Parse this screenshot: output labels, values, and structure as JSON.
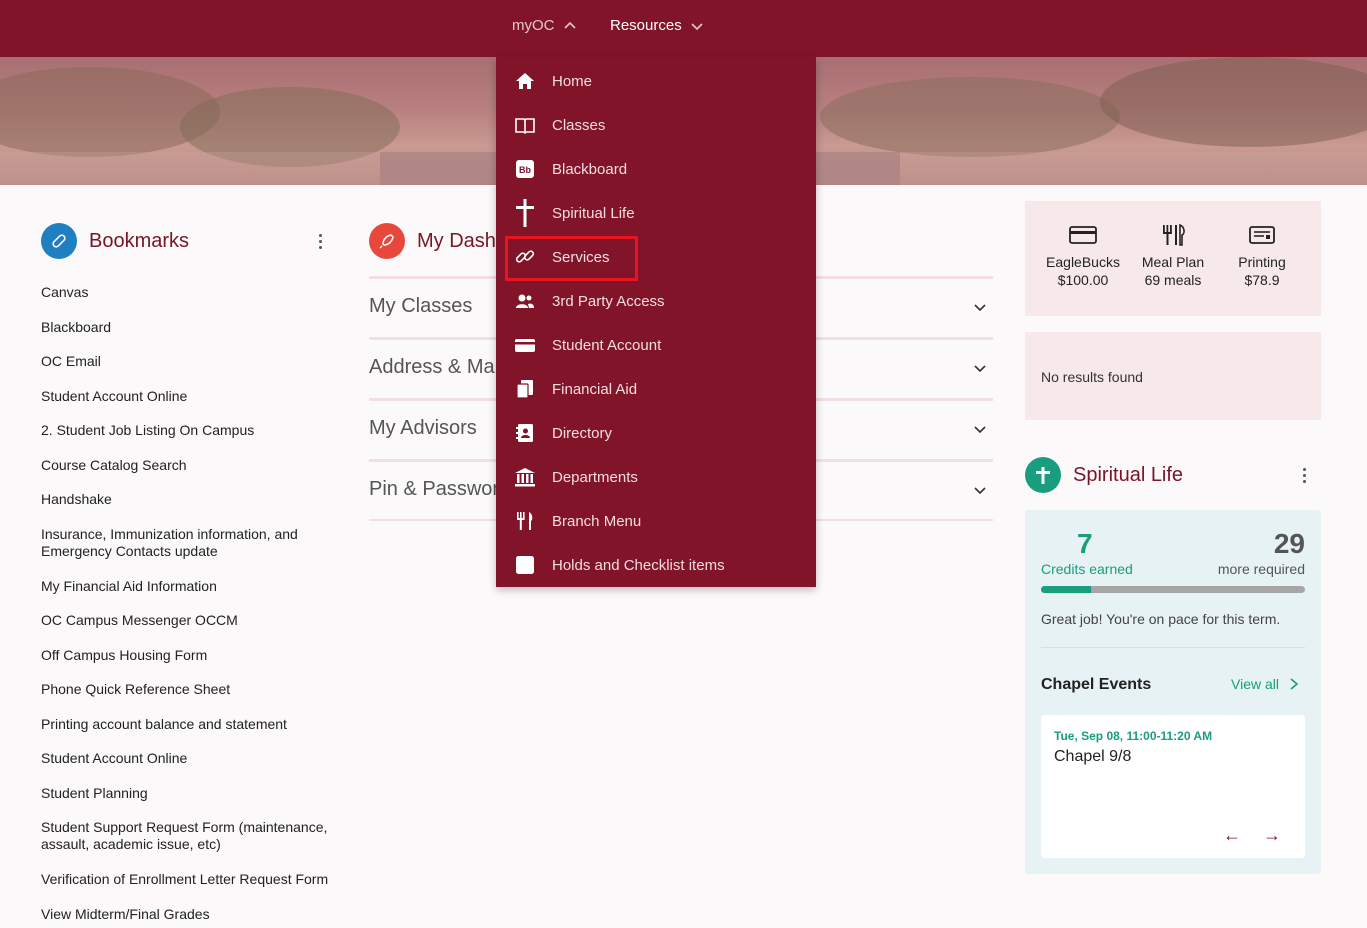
{
  "nav": {
    "myoc_label": "myOC",
    "resources_label": "Resources"
  },
  "bookmarks": {
    "title": "Bookmarks",
    "items": [
      "Canvas",
      "Blackboard",
      "OC Email",
      "Student Account Online",
      "2. Student Job Listing On Campus",
      "Course Catalog Search",
      "Handshake",
      "Insurance, Immunization information, and Emergency Contacts update",
      "My Financial Aid Information",
      "OC Campus Messenger OCCM",
      "Off Campus Housing Form",
      "Phone Quick Reference Sheet",
      "Printing account balance and statement",
      "Student Account Online",
      "Student Planning",
      "Student Support Request Form (maintenance, assault, academic issue, etc)",
      "Verification of Enrollment Letter Request Form",
      "View Midterm/Final Grades"
    ]
  },
  "dashboard": {
    "title": "My Dash",
    "sections": [
      "My Classes",
      "Address & Mai",
      "My Advisors",
      "Pin & Passwor"
    ]
  },
  "menu": {
    "items": [
      {
        "label": "Home",
        "icon": "home-icon"
      },
      {
        "label": "Classes",
        "icon": "book-icon"
      },
      {
        "label": "Blackboard",
        "icon": "blackboard-icon"
      },
      {
        "label": "Spiritual Life",
        "icon": "cross-icon"
      },
      {
        "label": "Services",
        "icon": "link-icon"
      },
      {
        "label": "3rd Party Access",
        "icon": "users-icon"
      },
      {
        "label": "Student Account",
        "icon": "credit-card-icon"
      },
      {
        "label": "Financial Aid",
        "icon": "financial-aid-icon"
      },
      {
        "label": "Directory",
        "icon": "address-book-icon"
      },
      {
        "label": "Departments",
        "icon": "building-icon"
      },
      {
        "label": "Branch Menu",
        "icon": "utensils-icon"
      },
      {
        "label": "Holds and Checklist items",
        "icon": "checkbox-icon"
      }
    ],
    "highlighted": "Services"
  },
  "wallet": {
    "items": [
      {
        "name": "EagleBucks",
        "value": "$100.00",
        "icon": "card-icon"
      },
      {
        "name": "Meal Plan",
        "value": "69 meals",
        "icon": "utensils-icon"
      },
      {
        "name": "Printing",
        "value": "$78.9",
        "icon": "printer-icon"
      }
    ]
  },
  "notice": {
    "text": "No results found"
  },
  "spiritual": {
    "title": "Spiritual Life",
    "credits_earned": "7",
    "credits_earned_label": "Credits earned",
    "more_required": "29",
    "more_required_label": "more required",
    "progress_fraction": 0.19,
    "message": "Great job! You're on pace for this term.",
    "events_title": "Chapel Events",
    "view_all": "View all",
    "event": {
      "date": "Tue, Sep 08, 11:00-11:20 AM",
      "name": "Chapel 9/8"
    },
    "prev_arrow": "←",
    "next_arrow": "→"
  },
  "colors": {
    "brand": "#82142a",
    "accent_green": "#1a9c7f",
    "highlight_red": "#e8141e"
  }
}
